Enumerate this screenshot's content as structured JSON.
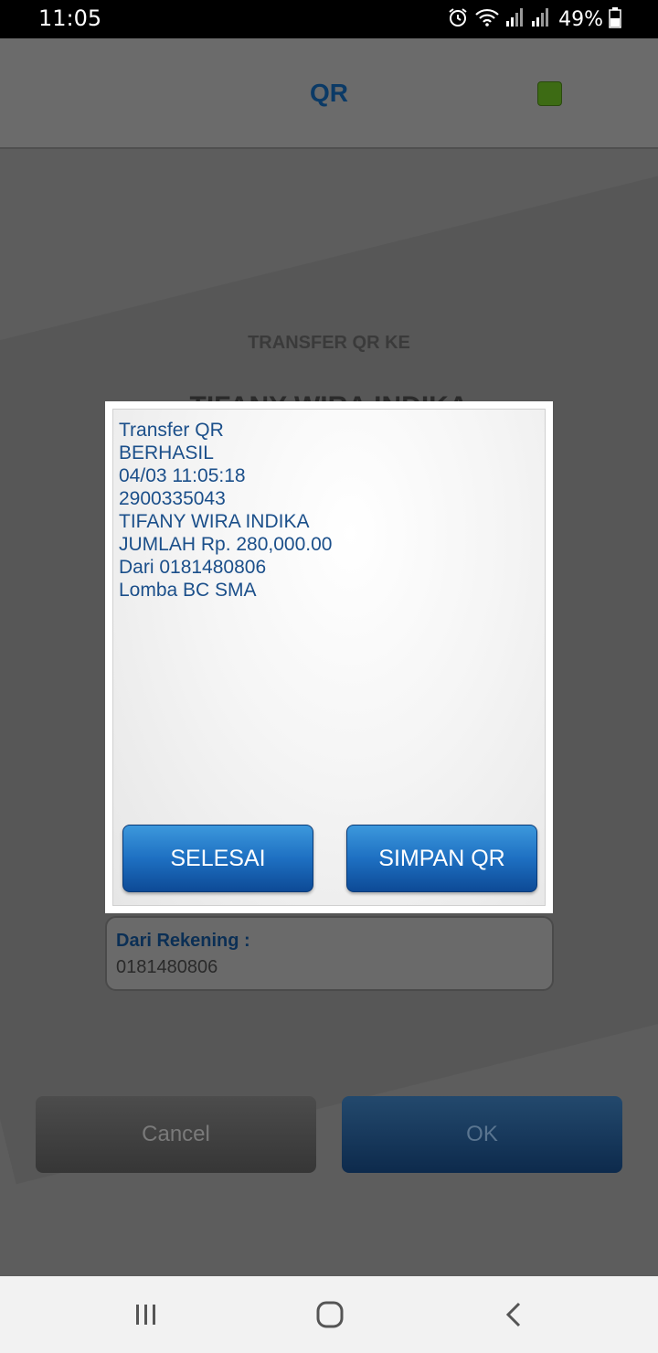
{
  "status_bar": {
    "time": "11:05",
    "battery_percent": "49%",
    "icons": [
      "alarm-icon",
      "wifi-icon",
      "signal-icon",
      "signal-icon",
      "battery-icon"
    ]
  },
  "header": {
    "title": "QR",
    "indicator_color": "#3d6b14"
  },
  "page": {
    "transfer_label": "TRANSFER QR KE",
    "recipient_name": "TIFANY WIRA INDIKA",
    "from_account_label": "Dari Rekening :",
    "from_account_value": "0181480806",
    "cancel_label": "Cancel",
    "ok_label": "OK"
  },
  "dialog": {
    "lines": [
      "Transfer QR",
      "BERHASIL",
      "04/03 11:05:18",
      "2900335043",
      "TIFANY WIRA INDIKA",
      "JUMLAH Rp. 280,000.00",
      "Dari 0181480806",
      "Lomba BC SMA"
    ],
    "done_label": "SELESAI",
    "save_qr_label": "SIMPAN QR",
    "text_color": "#1b4f8a",
    "button_color": "#1e70c2"
  },
  "nav_bar": {
    "icons": [
      "recent-apps-icon",
      "home-icon",
      "back-icon"
    ]
  }
}
